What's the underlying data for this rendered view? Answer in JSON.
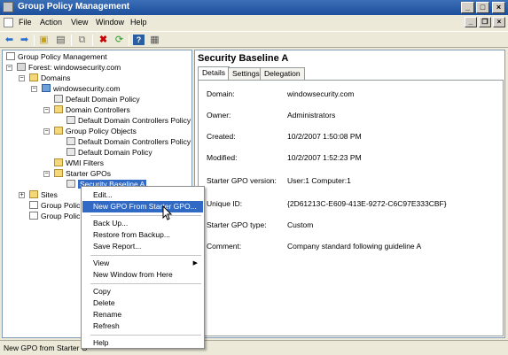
{
  "window": {
    "title": "Group Policy Management"
  },
  "menubar": {
    "items": [
      "File",
      "Action",
      "View",
      "Window",
      "Help"
    ]
  },
  "toolbar": {
    "buttons": [
      "back-icon",
      "forward-icon",
      "up-icon",
      "show-hide-tree-icon",
      "copy-icon",
      "delete-icon",
      "refresh-icon",
      "help-icon",
      "properties-icon"
    ]
  },
  "tree": {
    "root": "Group Policy Management",
    "forest": "Forest: windowsecurity.com",
    "domains": "Domains",
    "domain": "windowsecurity.com",
    "default_domain_policy": "Default Domain Policy",
    "domain_controllers": "Domain Controllers",
    "default_dc_policy": "Default Domain Controllers Policy",
    "gpo_container": "Group Policy Objects",
    "gpo_dc_policy": "Default Domain Controllers Policy",
    "gpo_domain_policy": "Default Domain Policy",
    "wmi_filters": "WMI Filters",
    "starter_gpos": "Starter GPOs",
    "selected": "Security Baseline A",
    "sites": "Sites",
    "group_policy_modeling": "Group Polic",
    "group_policy_results": "Group Polic"
  },
  "details": {
    "heading": "Security Baseline A",
    "tabs": [
      "Details",
      "Settings",
      "Delegation"
    ],
    "properties": [
      {
        "label": "Domain:",
        "value": "windowsecurity.com"
      },
      {
        "label": "Owner:",
        "value": "Administrators"
      },
      {
        "label": "Created:",
        "value": "10/2/2007 1:50:08 PM"
      },
      {
        "label": "Modified:",
        "value": "10/2/2007 1:52:23 PM"
      },
      {
        "label": "Starter GPO version:",
        "value": "User:1 Computer:1"
      },
      {
        "label": "Unique ID:",
        "value": "{2D61213C-E609-413E-9272-C6C97E333CBF}"
      },
      {
        "label": "Starter GPO type:",
        "value": "Custom"
      },
      {
        "label": "Comment:",
        "value": "Company standard following guideline A"
      }
    ]
  },
  "context_menu": {
    "items": [
      {
        "label": "Edit..."
      },
      {
        "label": "New GPO From Starter GPO..."
      },
      {
        "label": "Back Up..."
      },
      {
        "label": "Restore from Backup..."
      },
      {
        "label": "Save Report..."
      },
      {
        "label": "View"
      },
      {
        "label": "New Window from Here"
      },
      {
        "label": "Copy"
      },
      {
        "label": "Delete"
      },
      {
        "label": "Rename"
      },
      {
        "label": "Refresh"
      },
      {
        "label": "Help"
      }
    ],
    "highlighted": "New GPO From Starter GPO..."
  },
  "status": {
    "text": "New GPO from Starter G"
  },
  "colors": {
    "title_bar": "#1d4f9c",
    "selection": "#316ac5",
    "delete_icon": "#cc0000"
  }
}
